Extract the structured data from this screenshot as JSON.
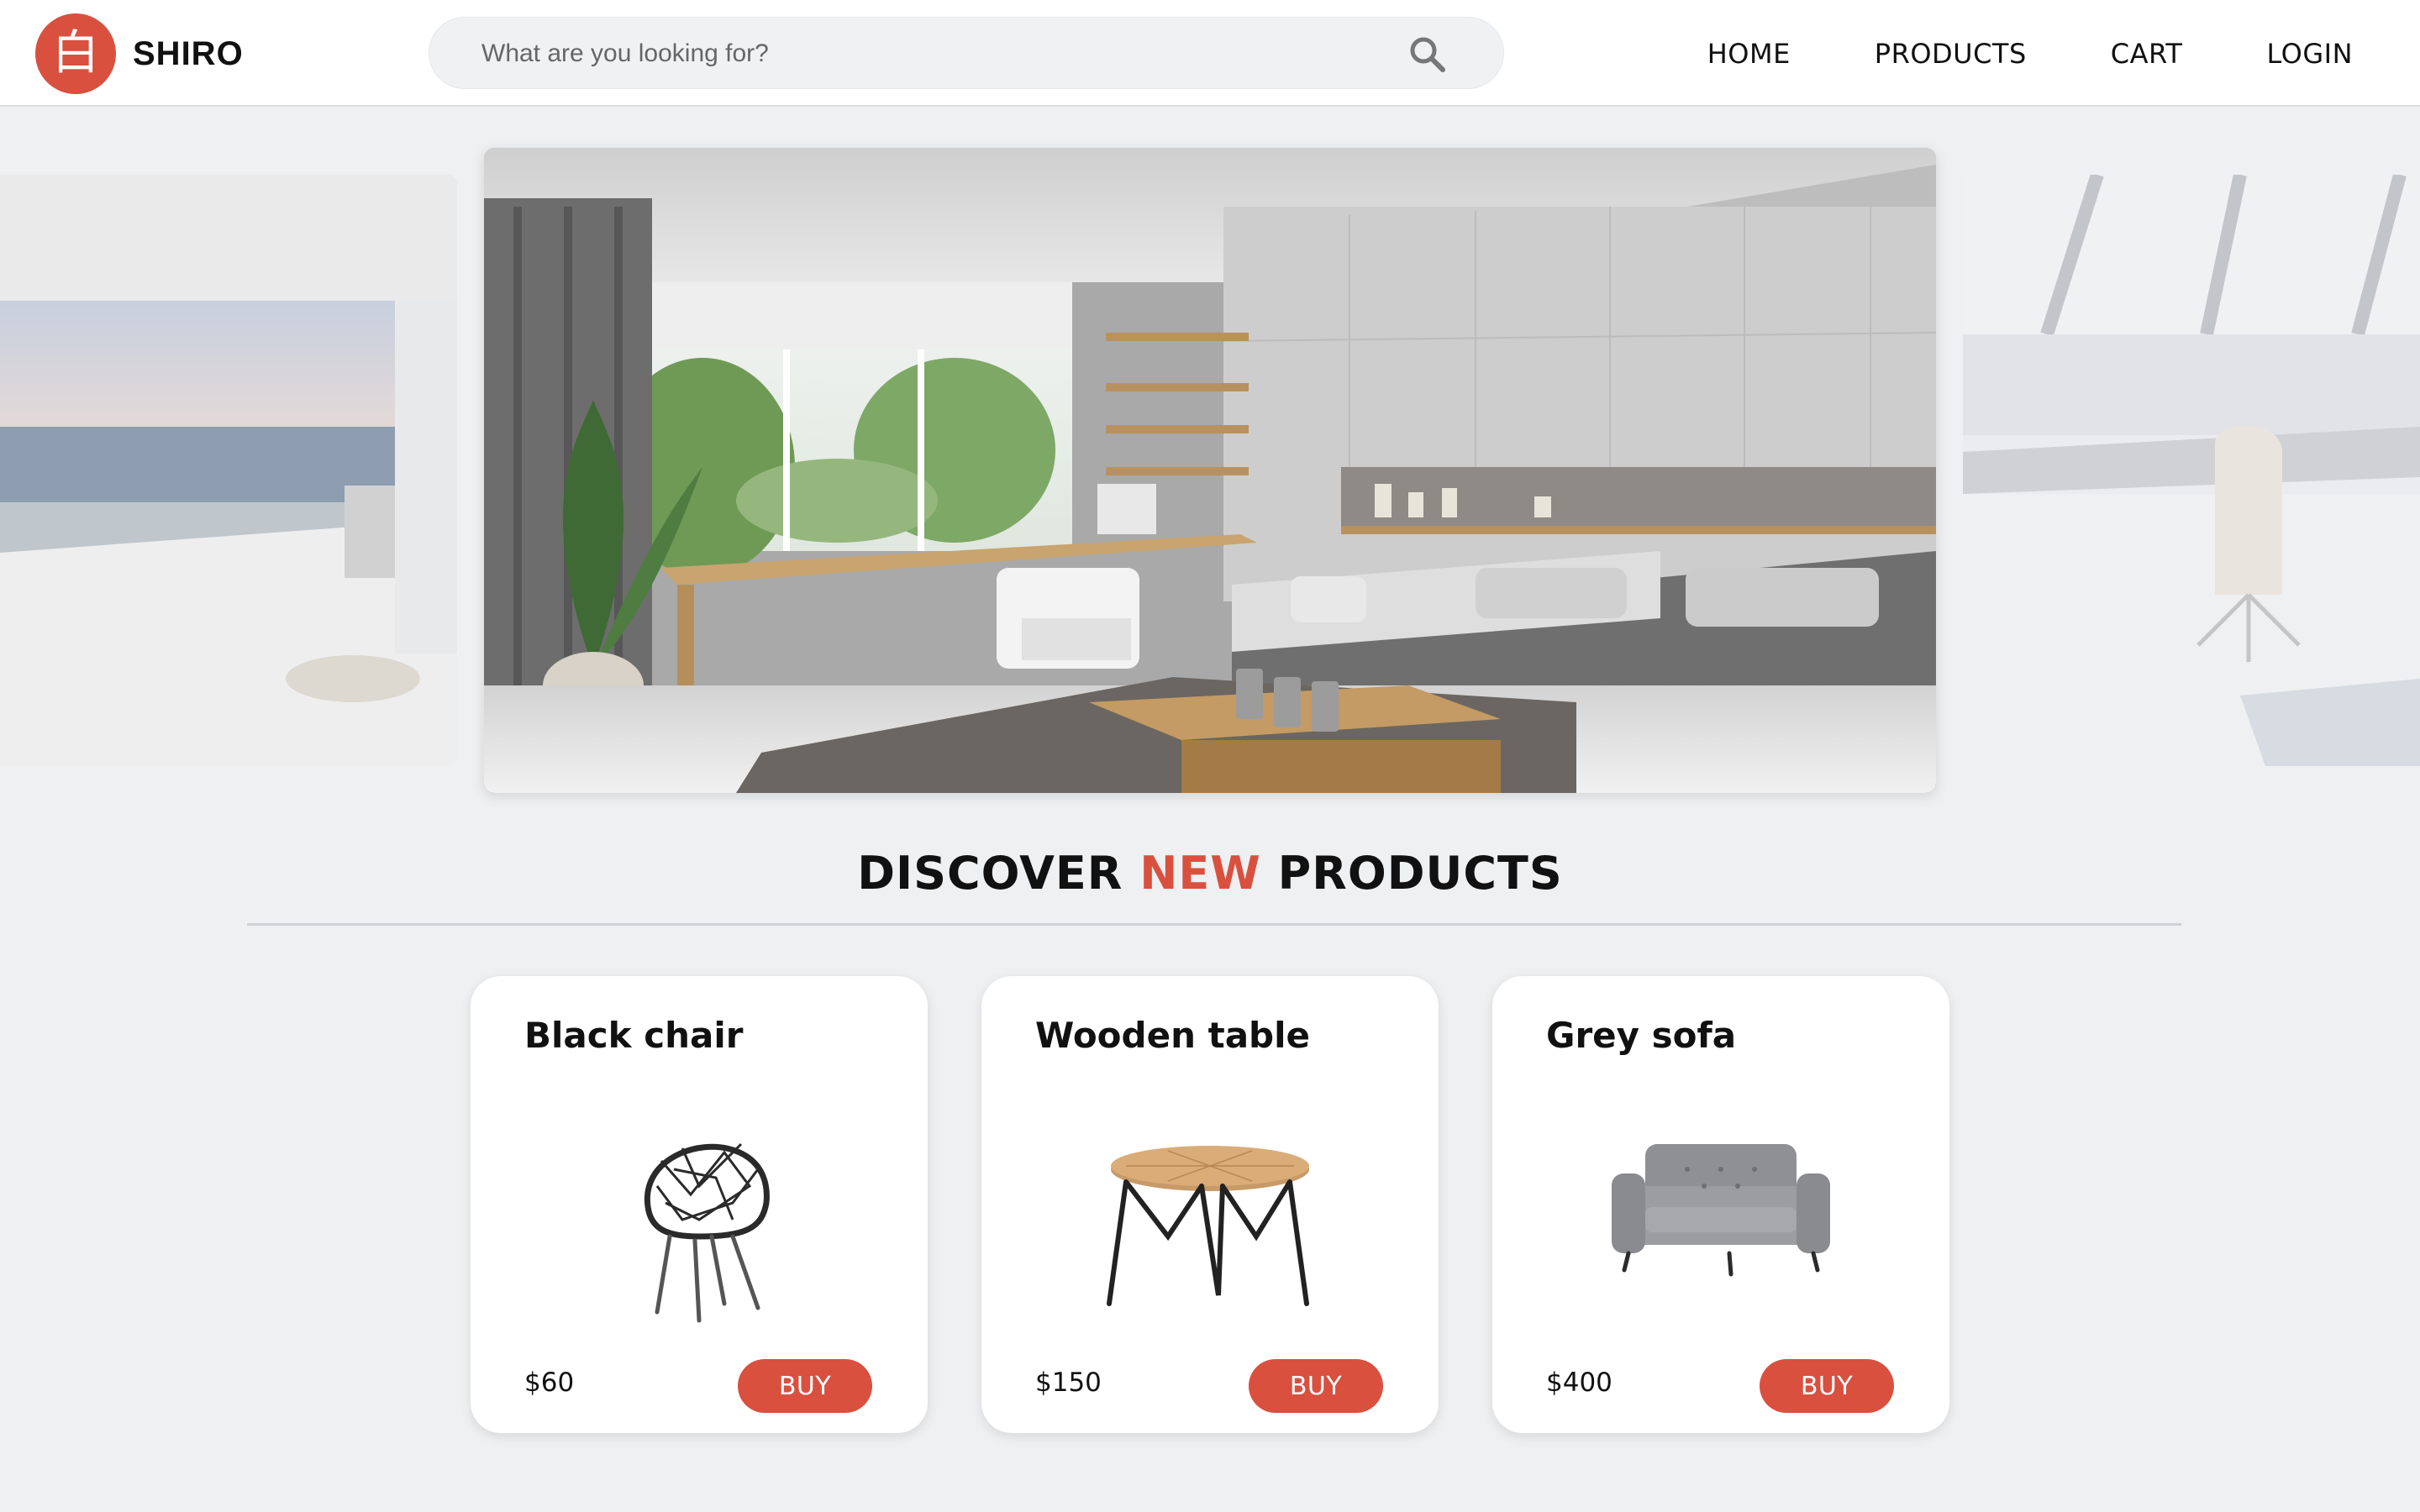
{
  "header": {
    "logo_glyph": "白",
    "brand": "SHIRO",
    "search": {
      "placeholder": "What are you looking for?",
      "icon": "search-icon"
    },
    "nav": [
      "HOME",
      "PRODUCTS",
      "CART",
      "LOGIN"
    ]
  },
  "carousel": {
    "slides": [
      "ocean-view-living-room",
      "modern-living-room",
      "bright-office-room"
    ],
    "active": 1
  },
  "section": {
    "title_pre": "DISCOVER",
    "title_accent": "NEW",
    "title_post": "PRODUCTS"
  },
  "products": [
    {
      "name": "Black chair",
      "price": "$60",
      "buy_label": "BUY",
      "image": "chair-image"
    },
    {
      "name": "Wooden table",
      "price": "$150",
      "buy_label": "BUY",
      "image": "table-image"
    },
    {
      "name": "Grey sofa",
      "price": "$400",
      "buy_label": "BUY",
      "image": "sofa-image"
    }
  ],
  "colors": {
    "accent": "#d9503f",
    "background": "#eff0f2",
    "card": "#ffffff"
  }
}
